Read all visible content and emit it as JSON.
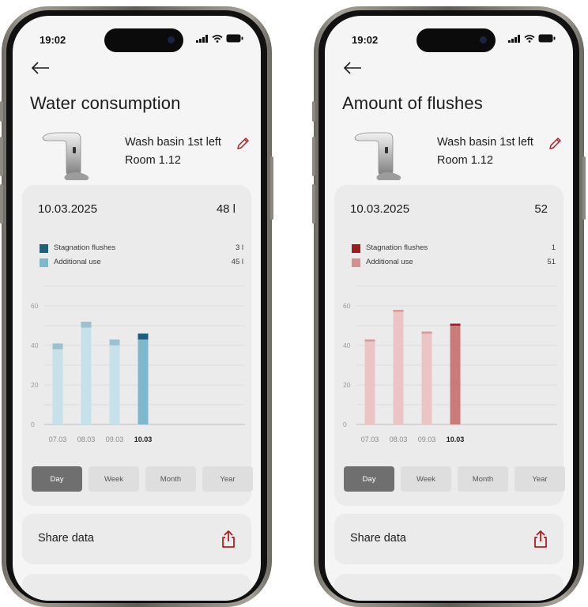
{
  "status_bar": {
    "time": "19:02"
  },
  "left": {
    "title": "Water consumption",
    "device": {
      "name": "Wash basin 1st left",
      "room": "Room 1.12"
    },
    "summary": {
      "date": "10.03.2025",
      "total": "48 l"
    },
    "legend": [
      {
        "label": "Stagnation flushes",
        "value": "3 l",
        "color": "#1e5f7a"
      },
      {
        "label": "Additional use",
        "value": "45 l",
        "color": "#7fb8cc"
      }
    ],
    "colors": {
      "primary": "#1e5f7a",
      "secondary": "#7fb8cc",
      "secondary_light": "#c6e1ea",
      "primary_light": "#9cc2cf"
    },
    "periods": [
      "Day",
      "Week",
      "Month",
      "Year"
    ],
    "active_period": "Day",
    "share_label": "Share data"
  },
  "right": {
    "title": "Amount of flushes",
    "device": {
      "name": "Wash basin 1st left",
      "room": "Room 1.12"
    },
    "summary": {
      "date": "10.03.2025",
      "total": "52"
    },
    "legend": [
      {
        "label": "Stagnation flushes",
        "value": "1",
        "color": "#9b1c1c"
      },
      {
        "label": "Additional use",
        "value": "51",
        "color": "#d4908e"
      }
    ],
    "colors": {
      "primary": "#9b1c1c",
      "secondary": "#c97b79",
      "secondary_light": "#ebc5c4",
      "primary_light": "#d49a99"
    },
    "periods": [
      "Day",
      "Week",
      "Month",
      "Year"
    ],
    "active_period": "Day",
    "share_label": "Share data"
  },
  "chart_data": [
    {
      "type": "bar",
      "stacked": true,
      "categories": [
        "07.03",
        "08.03",
        "09.03",
        "10.03"
      ],
      "highlighted_category": "10.03",
      "series": [
        {
          "name": "Additional use",
          "values": [
            38,
            49,
            40,
            43
          ]
        },
        {
          "name": "Stagnation flushes",
          "values": [
            3,
            3,
            3,
            3
          ]
        }
      ],
      "yticks": [
        0,
        20,
        40,
        60
      ],
      "ylim": [
        0,
        70
      ],
      "grid": true
    },
    {
      "type": "bar",
      "stacked": true,
      "categories": [
        "07.03",
        "08.03",
        "09.03",
        "10.03"
      ],
      "highlighted_category": "10.03",
      "series": [
        {
          "name": "Additional use",
          "values": [
            42,
            57,
            46,
            50
          ]
        },
        {
          "name": "Stagnation flushes",
          "values": [
            1,
            1,
            1,
            1
          ]
        }
      ],
      "yticks": [
        0,
        20,
        40,
        60
      ],
      "ylim": [
        0,
        70
      ],
      "grid": true
    }
  ]
}
